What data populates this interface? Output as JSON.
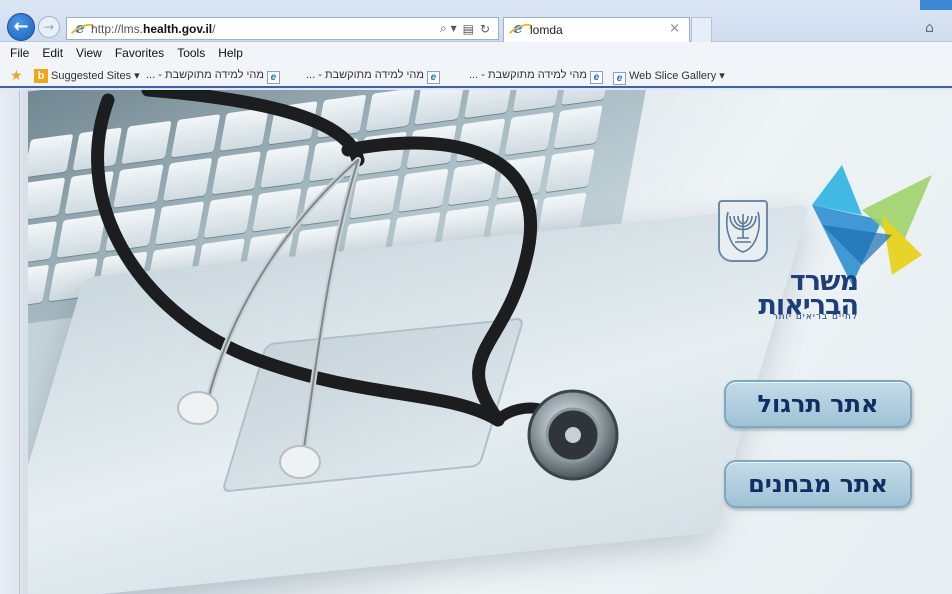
{
  "browser": {
    "address_url_prefix": "http://lms.",
    "address_url_host": "health.gov.il",
    "address_url_suffix": "/",
    "search_icon": "search-icon",
    "tab_title": "lomda",
    "tab_close": "×"
  },
  "menu": {
    "items": [
      "File",
      "Edit",
      "View",
      "Favorites",
      "Tools",
      "Help"
    ]
  },
  "favorites": {
    "suggested_sites": "Suggested Sites ▾",
    "items": [
      "מהי למידה מתוקשבת - ...",
      "מהי למידה מתוקשבת - ...",
      "מהי למידה מתוקשבת - ...",
      "מהי למידה מתוקשבת - ..."
    ],
    "web_slice_gallery": "Web Slice Gallery ▾"
  },
  "logo": {
    "name_line1": "משרד",
    "name_line2": "הבריאות",
    "tagline": "לחיים בריאים יותר"
  },
  "buttons": {
    "practice_site": "אתר תרגול",
    "exams_site": "אתר מבחנים"
  },
  "colors": {
    "logo_blue": "#1d3f78",
    "button_fill": "#a9c9db",
    "logo_cyan": "#37b6e0",
    "logo_yellow": "#e8d21c"
  }
}
